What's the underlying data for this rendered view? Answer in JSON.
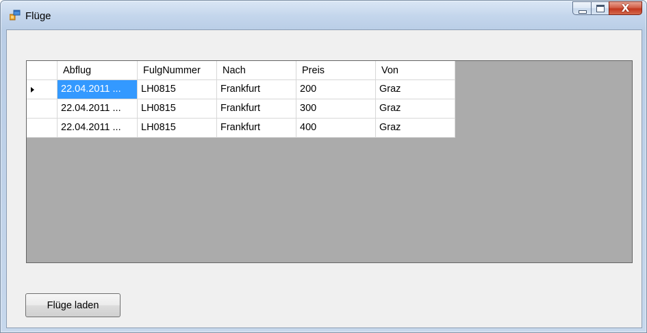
{
  "window": {
    "title": "Flüge",
    "icon": "winforms-app-icon",
    "controls": [
      "minimize-icon",
      "maximize-icon",
      "close-icon"
    ],
    "close_glyph": "X"
  },
  "grid": {
    "columns": [
      "Abflug",
      "FulgNummer",
      "Nach",
      "Preis",
      "Von"
    ],
    "rows": [
      [
        "22.04.2011 ...",
        "LH0815",
        "Frankfurt",
        "200",
        "Graz"
      ],
      [
        "22.04.2011 ...",
        "LH0815",
        "Frankfurt",
        "300",
        "Graz"
      ],
      [
        "22.04.2011 ...",
        "LH0815",
        "Frankfurt",
        "400",
        "Graz"
      ]
    ],
    "current_row": 0,
    "selection_color": "#3399ff",
    "empty_area_color": "#ababab"
  },
  "load_button": {
    "label": "Flüge laden"
  }
}
